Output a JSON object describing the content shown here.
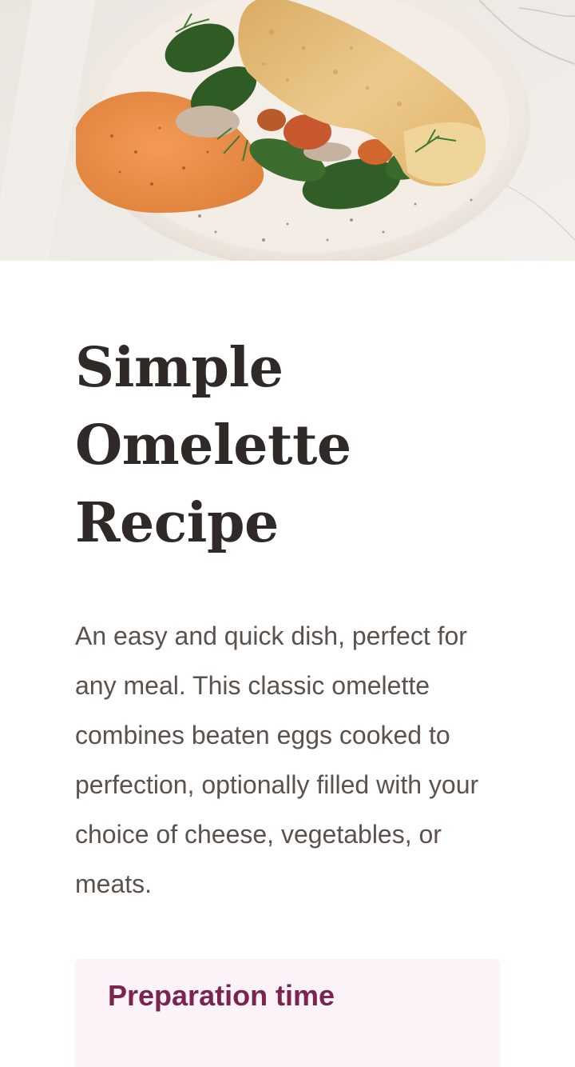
{
  "hero_image": {
    "icon": "omelette-with-spinach-photo",
    "colors": {
      "marble": "#ece8e3",
      "plate": "#f2ece6",
      "crepe": "#e6c27f",
      "sauce": "#ec9450",
      "greens": "#2f5b25"
    }
  },
  "recipe": {
    "title_lines": [
      "Simple",
      "Omelette",
      "Recipe"
    ],
    "description": "An easy and quick dish, perfect for any meal. This classic omelette combines beaten eggs cooked to perfection, optionally filled with your choice of cheese, vegetables, or meats.",
    "preparation": {
      "heading": "Preparation time"
    }
  },
  "theme": {
    "title_color": "#2f2a27",
    "body_color": "#5b524c",
    "accent_color": "#7a2550",
    "card_background": "#fcf3f9"
  }
}
